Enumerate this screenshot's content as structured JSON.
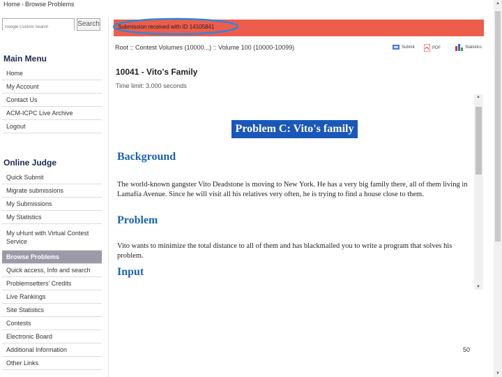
{
  "breadcrumb": {
    "home": "Home",
    "separator": "›",
    "current": "Browse Problems"
  },
  "search": {
    "placeholder": "Google Custom Search",
    "button": "Search"
  },
  "main_menu": {
    "title": "Main Menu",
    "items": [
      "Home",
      "My Account",
      "Contact Us",
      "ACM-ICPC Live Archive",
      "Logout"
    ]
  },
  "online_judge": {
    "title": "Online Judge",
    "items": [
      "Quick Submit",
      "Migrate submissions",
      "My Submissions",
      "My Statistics",
      "My uHunt with Virtual Contest Service",
      "Browse Problems",
      "Quick access, Info and search",
      "Problemsetters' Credits",
      "Live Rankings",
      "Site Statistics",
      "Contests",
      "Electronic Board",
      "Additional Information",
      "Other Links"
    ],
    "active_index": 5
  },
  "banner": {
    "text": "Submission received with ID 14105841",
    "color": "#ec5d4b"
  },
  "path": "Root :: Contest Volumes (10000...) :: Volume 100 (10000-10099)",
  "actions": [
    {
      "label": "Submit",
      "icon": "submit-icon"
    },
    {
      "label": "PDF",
      "icon": "pdf-icon"
    },
    {
      "label": "Statistics",
      "icon": "statistics-icon"
    }
  ],
  "problem": {
    "title": "10041 - Vito's Family",
    "time_limit": "Time limit: 3.000 seconds",
    "heading": "Problem C: Vito's family",
    "sections": [
      {
        "heading": "Background",
        "text": "The world-known gangster Vito Deadstone is moving to New York. He has a very big family there, all of them living in Lamafia Avenue. Since he will visit all his relatives very often, he is trying to find a house close to them."
      },
      {
        "heading": "Problem",
        "text": "Vito wants to minimize the total distance to all of them and has blackmailed you to write a program that solves his problem."
      },
      {
        "heading": "Input",
        "text": ""
      }
    ]
  },
  "page_number": "50",
  "colors": {
    "heading_box": "#1a57b8",
    "section_heading": "#1a63b0",
    "active_menu": "#9a9aa8",
    "highlight_ellipse": "#2e86de"
  }
}
